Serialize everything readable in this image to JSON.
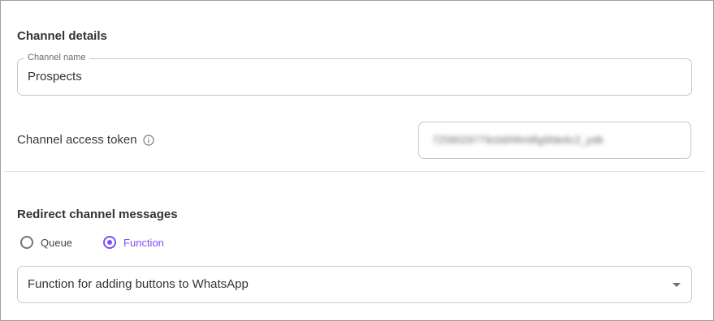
{
  "channel_details": {
    "title": "Channel details",
    "name_label": "Channel name",
    "name_value": "Prospects"
  },
  "access_token": {
    "label": "Channel access token",
    "info_icon": "info-circle-icon",
    "value": "7258029779cb6f4fm9fg6fde6c2_pdk"
  },
  "redirect": {
    "title": "Redirect channel messages",
    "options": [
      {
        "label": "Queue",
        "selected": false
      },
      {
        "label": "Function",
        "selected": true
      }
    ],
    "function_select_value": "Function for adding buttons to WhatsApp",
    "caret_icon": "caret-down-icon"
  },
  "colors": {
    "accent": "#7c4dff",
    "border": "#c8c8c8",
    "divider": "#e3e3e3"
  }
}
